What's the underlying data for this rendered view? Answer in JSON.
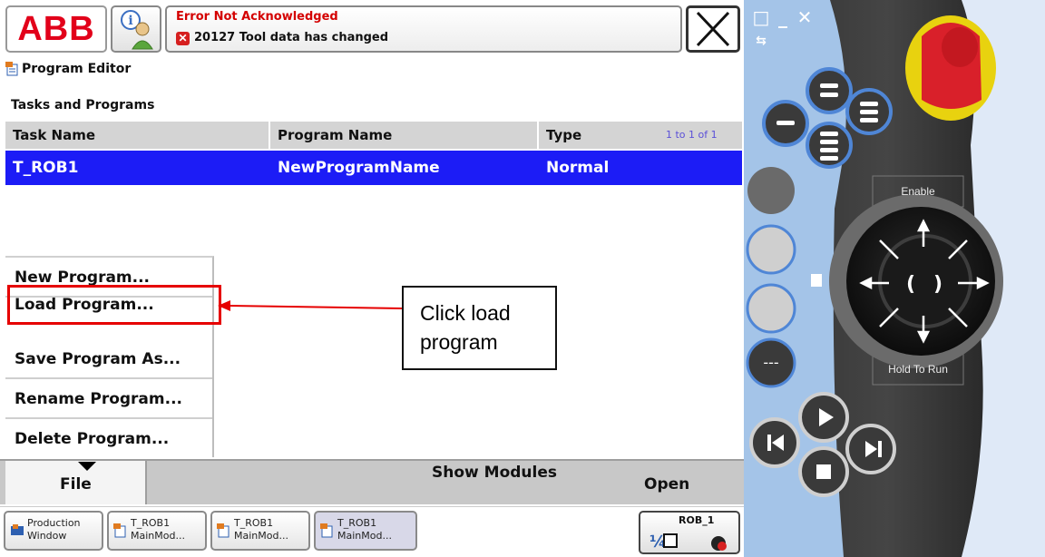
{
  "statusbar": {
    "logo_text": "ABB",
    "info_icon": "info-user-icon",
    "message_title": "Error Not Acknowledged",
    "message_text": "20127 Tool data has changed",
    "close_icon": "close-icon"
  },
  "app": {
    "title": "Program Editor",
    "icon": "program-editor-icon"
  },
  "section": {
    "title": "Tasks and Programs"
  },
  "table": {
    "headers": [
      "Task Name",
      "Program Name",
      "Type"
    ],
    "count": "1 to 1 of 1",
    "rows": [
      {
        "task": "T_ROB1",
        "program": "NewProgramName",
        "type": "Normal",
        "selected": true
      }
    ],
    "selected_color": "#1c1cf6"
  },
  "file_menu": {
    "items": [
      "New Program...",
      "Load Program...",
      "Save Program As...",
      "Rename Program...",
      "Delete Program..."
    ],
    "highlighted_item": "Load Program..."
  },
  "callout": {
    "text": "Click load program",
    "color": "#e60000"
  },
  "command_bar": {
    "file": "File",
    "show_modules": "Show Modules",
    "open": "Open"
  },
  "taskbar": {
    "items": [
      {
        "label1": "Production",
        "label2": "Window"
      },
      {
        "label1": "T_ROB1",
        "label2": "MainMod..."
      },
      {
        "label1": "T_ROB1",
        "label2": "MainMod..."
      },
      {
        "label1": "T_ROB1",
        "label2": "MainMod..."
      }
    ],
    "quickset_label": "ROB_1"
  },
  "pendant": {
    "enable_label": "Enable",
    "hold_to_run_label": "Hold To Run",
    "emergency_stop_color": "#d9202a"
  }
}
